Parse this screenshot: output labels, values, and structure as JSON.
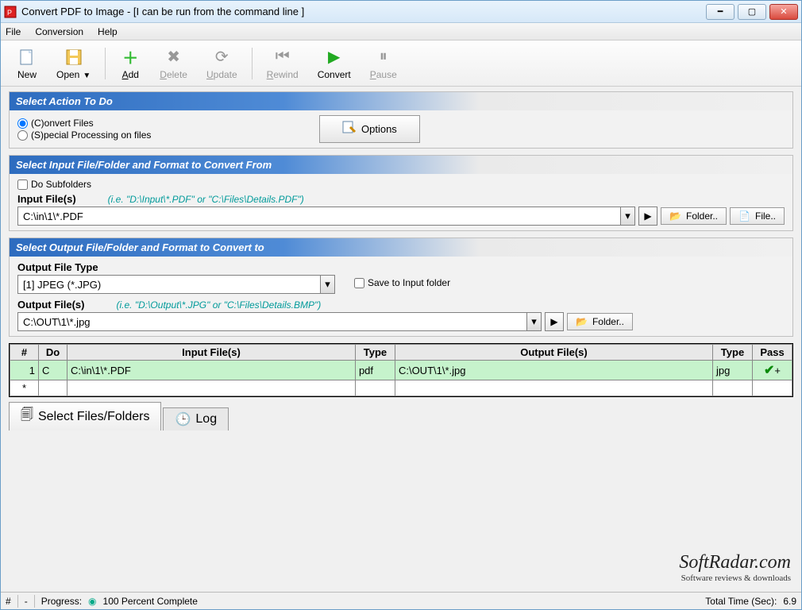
{
  "window": {
    "title": "Convert PDF to Image - [I can be run from the command line ]"
  },
  "menubar": {
    "file": "File",
    "conversion": "Conversion",
    "help": "Help"
  },
  "toolbar": {
    "new": "New",
    "open": "Open",
    "add": "Add",
    "delete": "Delete",
    "update": "Update",
    "rewind": "Rewind",
    "convert": "Convert",
    "pause": "Pause"
  },
  "section1": {
    "title": "Select Action To Do",
    "radio_convert": "(C)onvert Files",
    "radio_special": "(S)pecial Processing on files",
    "options_btn": "Options"
  },
  "section2": {
    "title": "Select Input File/Folder and Format to Convert From",
    "subfolders": "Do Subfolders",
    "input_label": "Input File(s)",
    "input_hint": "(i.e. \"D:\\Input\\*.PDF\"   or  \"C:\\Files\\Details.PDF\")",
    "input_value": "C:\\in\\1\\*.PDF",
    "folder_btn": "Folder..",
    "file_btn": "File.."
  },
  "section3": {
    "title": "Select Output File/Folder and Format to Convert to",
    "out_type_label": "Output File Type",
    "out_type_value": "[1] JPEG (*.JPG)",
    "save_to_input": "Save to Input folder",
    "output_label": "Output File(s)",
    "output_hint": "(i.e. \"D:\\Output\\*.JPG\"   or  \"C:\\Files\\Details.BMP\")",
    "output_value": "C:\\OUT\\1\\*.jpg",
    "folder_btn": "Folder.."
  },
  "grid": {
    "cols": {
      "num": "#",
      "do": "Do",
      "in": "Input File(s)",
      "type": "Type",
      "out": "Output File(s)",
      "type2": "Type",
      "pass": "Pass"
    },
    "rows": [
      {
        "num": "1",
        "do": "C",
        "in": "C:\\in\\1\\*.PDF",
        "type": "pdf",
        "out": "C:\\OUT\\1\\*.jpg",
        "type2": "jpg",
        "pass": "✔+"
      }
    ],
    "newrow_mark": "*"
  },
  "tabs": {
    "select": "Select Files/Folders",
    "log": "Log"
  },
  "status": {
    "hash": "#",
    "dash": "-",
    "progress_label": "Progress:",
    "progress_text": "100 Percent Complete",
    "time_label": "Total Time (Sec):",
    "time_val": "6.9"
  },
  "brand": {
    "main": "SoftRadar.com",
    "sub": "Software reviews & downloads"
  }
}
